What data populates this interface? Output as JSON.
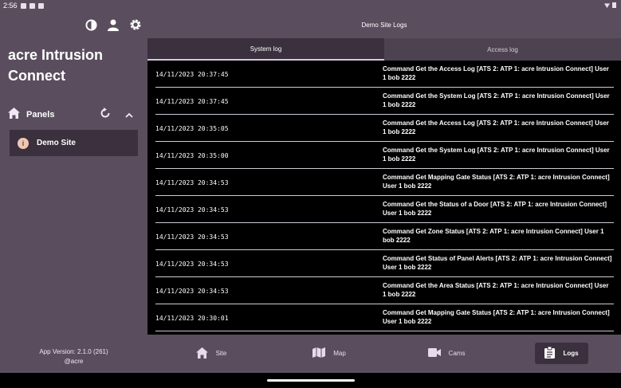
{
  "status_bar": {
    "time": "2:56"
  },
  "sidebar": {
    "app_title": "acre Intrusion Connect",
    "panels_label": "Panels",
    "site_item_label": "Demo Site",
    "version": "App Version: 2.1.0 (261)",
    "copyright": "@acre"
  },
  "main": {
    "title": "Demo Site Logs",
    "tabs": [
      {
        "label": "System log",
        "active": true
      },
      {
        "label": "Access log",
        "active": false
      }
    ],
    "logs": [
      {
        "timestamp": "14/11/2023 20:37:45",
        "message": "Command  Get the Access Log [ATS 2: ATP 1: acre Intrusion Connect] User 1 bob 2222"
      },
      {
        "timestamp": "14/11/2023 20:37:45",
        "message": "Command  Get the System Log [ATS 2: ATP 1: acre Intrusion Connect] User 1 bob 2222"
      },
      {
        "timestamp": "14/11/2023 20:35:05",
        "message": "Command  Get the Access Log [ATS 2: ATP 1: acre Intrusion Connect] User 1 bob 2222"
      },
      {
        "timestamp": "14/11/2023 20:35:00",
        "message": "Command  Get the System Log [ATS 2: ATP 1: acre Intrusion Connect] User 1 bob 2222"
      },
      {
        "timestamp": "14/11/2023 20:34:53",
        "message": "Command  Get Mapping Gate Status [ATS 2: ATP 1: acre Intrusion Connect] User 1 bob 2222"
      },
      {
        "timestamp": "14/11/2023 20:34:53",
        "message": "Command  Get the Status of a Door [ATS 2: ATP 1: acre Intrusion Connect] User 1 bob 2222"
      },
      {
        "timestamp": "14/11/2023 20:34:53",
        "message": "Command  Get Zone Status [ATS 2: ATP 1: acre Intrusion Connect] User 1 bob 2222"
      },
      {
        "timestamp": "14/11/2023 20:34:53",
        "message": "Command  Get Status of Panel Alerts [ATS 2: ATP 1: acre Intrusion Connect] User 1 bob 2222"
      },
      {
        "timestamp": "14/11/2023 20:34:53",
        "message": "Command  Get the Area Status [ATS 2: ATP 1: acre Intrusion Connect] User 1 bob 2222"
      },
      {
        "timestamp": "14/11/2023 20:30:01",
        "message": "Command  Get Mapping Gate Status [ATS 2: ATP 1: acre Intrusion Connect] User 1 bob 2222"
      }
    ]
  },
  "bottom_nav": [
    {
      "label": "Site",
      "icon": "home-icon",
      "active": false
    },
    {
      "label": "Map",
      "icon": "map-icon",
      "active": false
    },
    {
      "label": "Cams",
      "icon": "camera-icon",
      "active": false
    },
    {
      "label": "Logs",
      "icon": "clipboard-icon",
      "active": true
    }
  ],
  "colors": {
    "sidebar_bg": "#5a4e5e",
    "selected_bg": "#3a303e",
    "log_bg": "#000000",
    "info_badge": "#f2c7b0"
  }
}
